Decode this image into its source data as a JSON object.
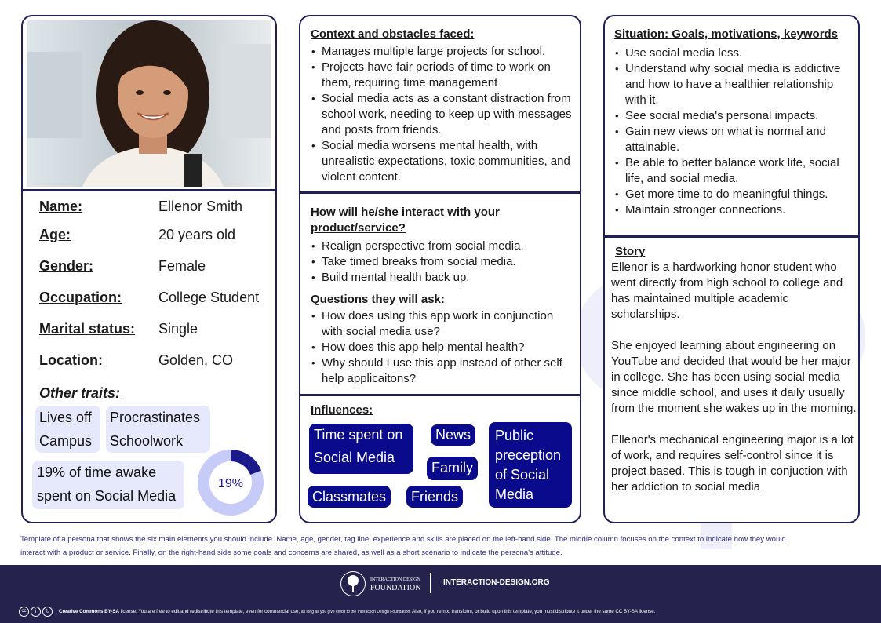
{
  "profile": {
    "fields": [
      {
        "label": "Name:",
        "value": "Ellenor Smith"
      },
      {
        "label": "Age:",
        "value": "20 years old"
      },
      {
        "label": "Gender:",
        "value": "Female"
      },
      {
        "label": "Occupation:",
        "value": "College Student"
      },
      {
        "label": "Marital status:",
        "value": "Single"
      },
      {
        "label": "Location:",
        "value": "Golden, CO"
      }
    ],
    "other_traits_label": "Other traits:",
    "traits": [
      {
        "line1": "Lives off",
        "line2": "Campus"
      },
      {
        "line1": "Procrastinates",
        "line2": "Schoolwork"
      }
    ],
    "social_stat": {
      "line1": "19% of time awake",
      "line2": "spent on Social Media"
    },
    "donut": {
      "label": "19%",
      "percent": 19,
      "fill_color": "#1a1a8a",
      "rest_color": "#c7cbf7"
    }
  },
  "context": {
    "title": "Context and obstacles faced:",
    "items": [
      "Manages multiple large projects for school.",
      "Projects have fair periods of time to work on them, requiring time management",
      "Social media acts as a constant distraction from school work, needing to keep up with messages and posts from friends.",
      "Social media worsens mental health, with unrealistic expectations, toxic communities, and violent content."
    ]
  },
  "interaction": {
    "title_line1": "How will he/she interact with your",
    "title_line2": "product/service?",
    "items": [
      "Realign perspective from social media.",
      "Take timed breaks from social media.",
      "Build mental health back up."
    ]
  },
  "questions": {
    "title": "Questions they will ask:",
    "items": [
      "How does using this app work in conjunction with social media use?",
      "How does this app help mental health?",
      "Why should I use this app instead of other self help applicaitons?"
    ]
  },
  "influences": {
    "title": "Influences:",
    "tags": {
      "time_line1": "Time spent on",
      "time_line2": "Social Media",
      "news": "News",
      "family": "Family",
      "classmates": "Classmates",
      "friends": "Friends",
      "public_1": "Public",
      "public_2": "preception",
      "public_3": "of Social",
      "public_4": "Media"
    }
  },
  "situation": {
    "title": "Situation: Goals, motivations, keywords",
    "items": [
      "Use social media less.",
      "Understand why social media is addictive and how to have a healthier relationship with it.",
      "See social media's personal impacts.",
      "Gain new views on what is normal and attainable.",
      "Be able to better balance work life, social life, and social media.",
      "Get more time to do meaningful things.",
      "Maintain stronger connections."
    ]
  },
  "story": {
    "title": "Story",
    "paragraphs": [
      "Ellenor is a hardworking honor student who went directly from high school to college and has maintained multiple academic scholarships.",
      "She enjoyed learning about engineering on YouTube and decided that would be her major in college. She has been using social media since middle school, and uses it daily usually from the moment she wakes up in the morning.",
      "Ellenor's mechanical engineering major is a lot of work, and requires self-control since it is project based. This is tough in conjuction with her addiction to social media"
    ]
  },
  "caption": {
    "line1": "Template of a persona that shows the six main elements you should include. Name, age, gender, tag line, experience and skills are placed on the left-hand side. The middle column focuses on the context to indicate how they would",
    "line2": "interact with a product or service. Finally, on the right-hand side some goals and concerns are shared, as well as a short scenario to indicate the persona's attitude."
  },
  "footer": {
    "logo_line1": "INTERACTION DESIGN",
    "logo_line2": "FOUNDATION",
    "site": "INTERACTION-DESIGN.ORG",
    "license_title": "Creative Commons BY-SA",
    "license_text": "license: You are free to edit and redistribute this template, even for commercial use,",
    "license_credit": "as long as you give credit to the Interaction Design Foundation.",
    "license_tail": "Also, if you remix, transform, or build upon this template, you must distribute it under the same CC BY-SA license.",
    "cc_icons": [
      "cc-icon",
      "by-icon",
      "sa-icon"
    ]
  },
  "colors": {
    "border": "#1f1f5a",
    "tag_bg": "#0a0a8c",
    "chip_bg": "#e6e8fb",
    "footer_bg": "#25234d"
  }
}
